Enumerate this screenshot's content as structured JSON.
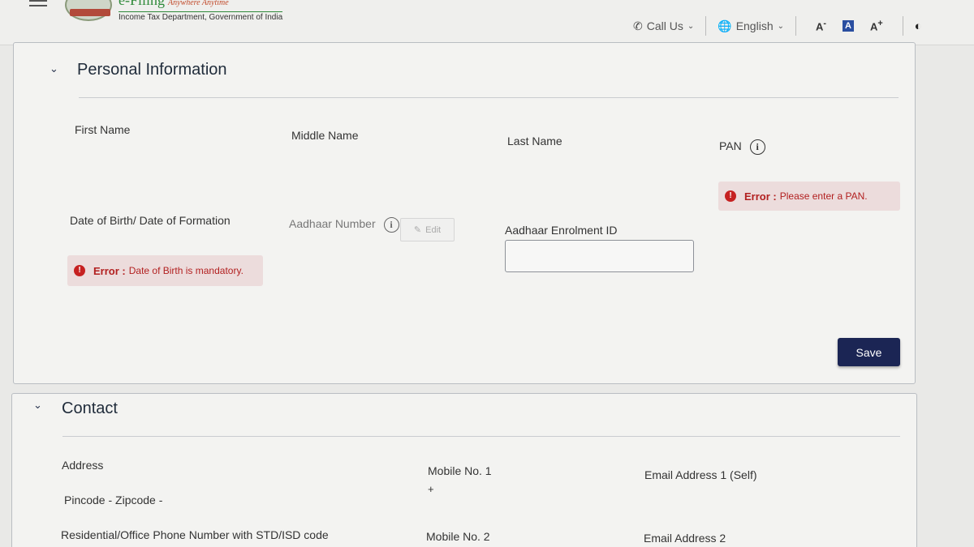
{
  "header": {
    "brand_title": "e-Filing",
    "brand_tagline": "Anywhere Anytime",
    "brand_subtitle": "Income Tax Department, Government of India",
    "call_us": "Call Us",
    "language": "English",
    "font_decrease": "A",
    "font_default": "A",
    "font_increase": "A",
    "icons": [
      "menu-icon",
      "emblem-logo",
      "phone-icon",
      "globe-icon",
      "contrast-icon"
    ]
  },
  "personal": {
    "title": "Personal Information",
    "first_name_label": "First Name",
    "middle_name_label": "Middle Name",
    "last_name_label": "Last Name",
    "pan_label": "PAN",
    "pan_error_prefix": "Error :",
    "pan_error_msg": "Please enter a PAN.",
    "dob_label": "Date of Birth/ Date of Formation",
    "dob_error_prefix": "Error :",
    "dob_error_msg": "Date of Birth is mandatory.",
    "aadhaar_label": "Aadhaar Number",
    "edit_label": "Edit",
    "enrolment_label": "Aadhaar Enrolment ID",
    "enrolment_value": "",
    "save_label": "Save"
  },
  "contact": {
    "title": "Contact",
    "address_label": "Address",
    "pincode_label": "Pincode - Zipcode -",
    "phone_label": "Residential/Office Phone Number with STD/ISD code",
    "mobile1_label": "Mobile No. 1",
    "mobile1_prefix": "+",
    "mobile2_label": "Mobile No. 2",
    "email1_label": "Email Address 1 (Self)",
    "email2_label": "Email Address 2"
  },
  "colors": {
    "error_text": "#b21f1f",
    "error_bg": "#ecdcdc",
    "save_button": "#1b2554",
    "brand_green": "#2f8a3a"
  }
}
